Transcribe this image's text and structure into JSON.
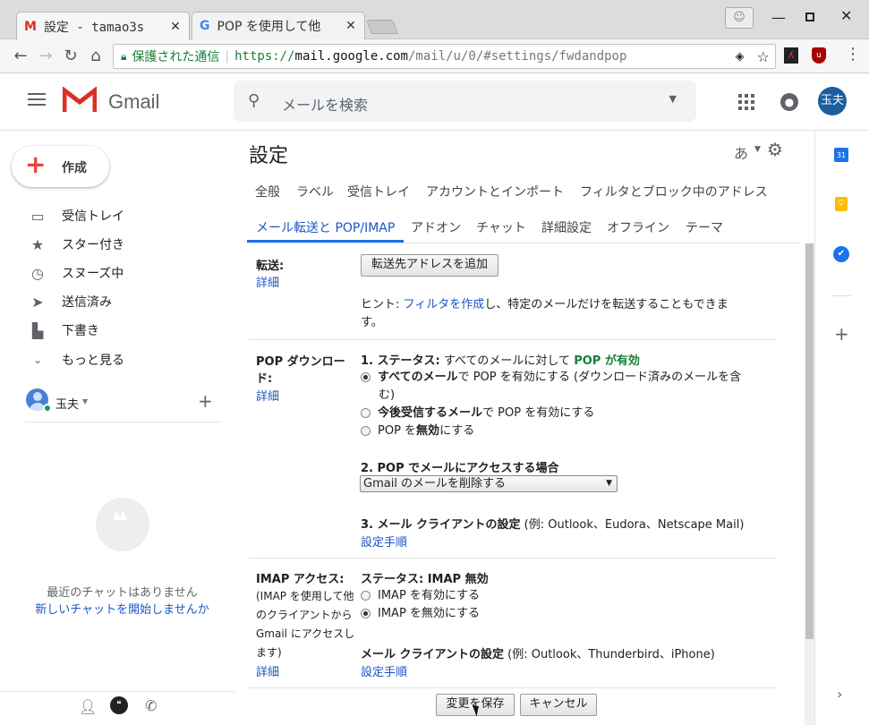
{
  "browser": {
    "tabs": [
      {
        "title": "設定 - tamao3s",
        "favicon": "gmail-icon"
      },
      {
        "title": "POP を使用して他",
        "favicon": "google-icon"
      }
    ],
    "secure_label": "保護された通信",
    "url_scheme": "https://",
    "url_host": "mail.google.com",
    "url_path": "/mail/u/0/#settings/fwdandpop"
  },
  "header": {
    "app_name": "Gmail",
    "search_placeholder": "メールを検索",
    "avatar_text": "玉夫"
  },
  "sidebar": {
    "compose_label": "作成",
    "items": [
      {
        "label": "受信トレイ",
        "icon": "inbox-icon"
      },
      {
        "label": "スター付き",
        "icon": "star-icon"
      },
      {
        "label": "スヌーズ中",
        "icon": "clock-icon"
      },
      {
        "label": "送信済み",
        "icon": "send-icon"
      },
      {
        "label": "下書き",
        "icon": "draft-icon"
      },
      {
        "label": "もっと見る",
        "icon": "chevron-down-icon"
      }
    ],
    "user_name": "玉夫",
    "no_chats": "最近のチャットはありません",
    "start_chat": "新しいチャットを開始しませんか"
  },
  "settings": {
    "title": "設定",
    "input_tool": "あ",
    "tabs_row1": [
      "全般",
      "ラベル",
      "受信トレイ",
      "アカウントとインポート",
      "フィルタとブロック中のアドレス"
    ],
    "tabs_row2": [
      "メール転送と POP/IMAP",
      "アドオン",
      "チャット",
      "詳細設定",
      "オフライン",
      "テーマ"
    ],
    "forwarding": {
      "label": "転送:",
      "details": "詳細",
      "add_button": "転送先アドレスを追加",
      "hint_prefix": "ヒント: ",
      "hint_link": "フィルタを作成",
      "hint_rest": "し、特定のメールだけを転送することもできま",
      "hint_rest2": "す。"
    },
    "pop": {
      "label1": "POP ダウンロー",
      "label2": "ド:",
      "details": "詳細",
      "status_prefix": "1. ステータス:",
      "status_text": "すべてのメールに対して",
      "status_value": "POP が有効",
      "opt1_bold": "すべてのメール",
      "opt1_rest": "で POP を有効にする (ダウンロード済みのメールを含",
      "opt1_rest2": "む)",
      "opt2_bold": "今後受信するメール",
      "opt2_rest": "で POP を有効にする",
      "opt3_pre": "POP を",
      "opt3_bold": "無効",
      "opt3_rest": "にする",
      "access_heading": "2. POP でメールにアクセスする場合",
      "access_selected": "Gmail のメールを削除する",
      "client_heading": "3. メール クライアントの設定",
      "client_examples": "(例: Outlook、Eudora、Netscape Mail)",
      "setup_link": "設定手順"
    },
    "imap": {
      "label": "IMAP アクセス:",
      "desc": [
        "(IMAP を使用して他",
        "のクライアントから",
        "Gmail にアクセスし",
        "ます)"
      ],
      "details": "詳細",
      "status": "ステータス: IMAP 無効",
      "opt_enable": "IMAP を有効にする",
      "opt_disable": "IMAP を無効にする",
      "client_heading": "メール クライアントの設定",
      "client_examples": "(例: Outlook、Thunderbird、iPhone)",
      "setup_link": "設定手順"
    },
    "save_button": "変更を保存",
    "cancel_button": "キャンセル"
  },
  "colors": {
    "gmail_red": "#d93025",
    "link": "#1a56c4",
    "pop_green": "#188038",
    "avatar_bg": "#1a5ea0"
  }
}
